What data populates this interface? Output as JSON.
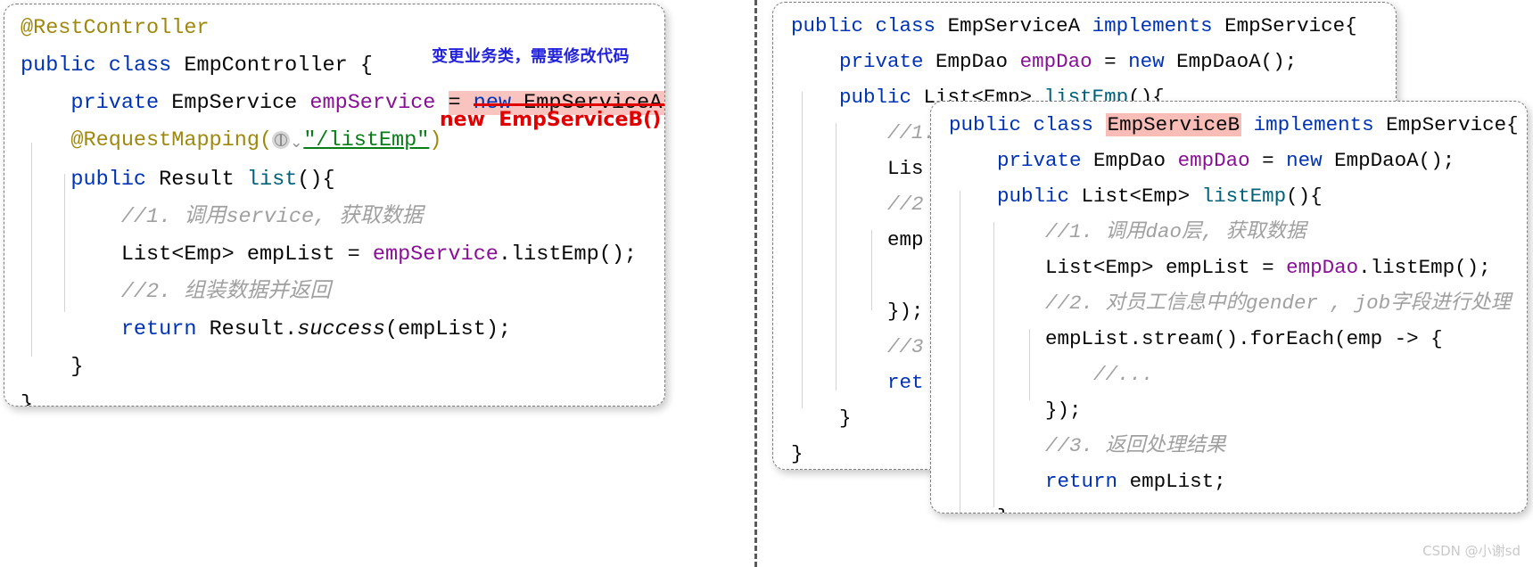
{
  "divider": {
    "name": "vertical-dashed-divider"
  },
  "watermark": {
    "text": "CSDN @小谢sd"
  },
  "annotations": {
    "change_note": "变更业务类，需要修改代码",
    "replacement": "new  EmpServiceB()"
  },
  "colors": {
    "keyword": "#0033b3",
    "annotation": "#9e880d",
    "field": "#871094",
    "method": "#00627a",
    "string": "#067d17",
    "comment": "#a0a0a0",
    "highlight_pink": "#f9c3bf",
    "strike_red": "#e10000",
    "note_blue": "#2323dd",
    "watermark_grey": "#c9c9c9"
  },
  "panels": {
    "controller": {
      "title": "EmpController",
      "lines": [
        {
          "id": "l1",
          "text": "@RestController"
        },
        {
          "id": "l2",
          "text": "public class EmpController {"
        },
        {
          "id": "l3",
          "text": "    private EmpService empService = new EmpServiceA();"
        },
        {
          "id": "l4",
          "text": "    @RequestMapping(\"/listEmp\")"
        },
        {
          "id": "l5",
          "text": "    public Result list(){"
        },
        {
          "id": "l6",
          "text": "        //1. 调用service, 获取数据"
        },
        {
          "id": "l7",
          "text": "        List<Emp> empList = empService.listEmp();"
        },
        {
          "id": "l8",
          "text": "        //2. 组装数据并返回"
        },
        {
          "id": "l9",
          "text": "        return Result.success(empList);"
        },
        {
          "id": "l10",
          "text": "    }"
        },
        {
          "id": "l11",
          "text": "}"
        }
      ],
      "tokens": {
        "rest_controller": "@RestController",
        "public": "public",
        "class": "class",
        "emp_controller": "EmpController",
        "brace_open": "{",
        "private": "private",
        "emp_service_type": "EmpService",
        "emp_service_field": "empService",
        "equals": "=",
        "new": "new",
        "emp_service_a_ctor": "EmpServiceA()",
        "semicolon": ";",
        "request_mapping": "@RequestMapping(",
        "list_emp_path": "\"/listEmp\"",
        "paren_close": ")",
        "result": "Result",
        "list_method": "list",
        "list_sig": "(){",
        "comment1": "//1. 调用service, 获取数据",
        "list_emp_decl": "List<Emp> empList = ",
        "emp_service_ref": "empService",
        "list_emp_call": ".listEmp();",
        "comment2": "//2. 组装数据并返回",
        "return": "return",
        "result_success": "Result.",
        "success": "success",
        "success_args": "(empList);",
        "close_inner": "}",
        "close_outer": "}"
      }
    },
    "service_a": {
      "title": "EmpServiceA",
      "lines": [
        {
          "id": "a1",
          "text": "public class EmpServiceA implements EmpService{"
        },
        {
          "id": "a2",
          "text": "    private EmpDao empDao = new EmpDaoA();"
        },
        {
          "id": "a3",
          "text": "    public List<Emp> listEmp(){"
        },
        {
          "id": "a4",
          "text": "        //1."
        },
        {
          "id": "a5",
          "text": "        Lis"
        },
        {
          "id": "a6",
          "text": "        //2"
        },
        {
          "id": "a7",
          "text": "        emp"
        },
        {
          "id": "a8",
          "text": ""
        },
        {
          "id": "a9",
          "text": "        });"
        },
        {
          "id": "a10",
          "text": "        //3"
        },
        {
          "id": "a11",
          "text": "        ret"
        },
        {
          "id": "a12",
          "text": "    }"
        },
        {
          "id": "a13",
          "text": "}"
        }
      ],
      "tokens": {
        "public": "public",
        "class": "class",
        "name": "EmpServiceA",
        "implements": "implements",
        "iface": "EmpService{",
        "private": "private",
        "emp_dao_type": "EmpDao",
        "emp_dao_field": "empDao",
        "equals": "=",
        "new": "new",
        "emp_dao_a": "EmpDaoA();",
        "list_type": "List<Emp>",
        "list_emp": "listEmp",
        "sig": "(){",
        "c1": "//1.",
        "lis": "Lis",
        "c2": "//2",
        "emp": "emp",
        "close_lambda": "});",
        "c3": "//3",
        "ret": "ret",
        "close_inner": "}",
        "close_outer": "}"
      }
    },
    "service_b": {
      "title": "EmpServiceB",
      "lines": [
        {
          "id": "b1",
          "text": "public class EmpServiceB implements EmpService{"
        },
        {
          "id": "b2",
          "text": "    private EmpDao empDao = new EmpDaoA();"
        },
        {
          "id": "b3",
          "text": "    public List<Emp> listEmp(){"
        },
        {
          "id": "b4",
          "text": "        //1. 调用dao层, 获取数据"
        },
        {
          "id": "b5",
          "text": "        List<Emp> empList = empDao.listEmp();"
        },
        {
          "id": "b6",
          "text": "        //2. 对员工信息中的gender , job字段进行处理"
        },
        {
          "id": "b7",
          "text": "        empList.stream().forEach(emp -> {"
        },
        {
          "id": "b8",
          "text": "            //..."
        },
        {
          "id": "b9",
          "text": "        });"
        },
        {
          "id": "b10",
          "text": "        //3. 返回处理结果"
        },
        {
          "id": "b11",
          "text": "        return empList;"
        },
        {
          "id": "b12",
          "text": "    }"
        },
        {
          "id": "b13",
          "text": "}"
        }
      ],
      "tokens": {
        "public": "public",
        "class": "class",
        "name": "EmpServiceB",
        "implements": "implements",
        "iface": "EmpService{",
        "private": "private",
        "emp_dao_type": "EmpDao",
        "emp_dao_field": "empDao",
        "equals": "=",
        "new": "new",
        "emp_dao_a": "EmpDaoA();",
        "list_type": "List<Emp>",
        "list_emp": "listEmp",
        "sig": "(){",
        "c1": "//1. 调用dao层, 获取数据",
        "decl": "List<Emp> empList = ",
        "emp_dao_ref": "empDao",
        "list_emp_call": ".listEmp();",
        "c2": "//2. 对员工信息中的gender , job字段进行处理",
        "stream": "empList.stream().forEach(emp -> {",
        "dots": "//...",
        "close_lambda": "});",
        "c3": "//3. 返回处理结果",
        "return": "return",
        "emp_list": "empList;",
        "close_inner": "}",
        "close_outer": "}"
      }
    }
  }
}
